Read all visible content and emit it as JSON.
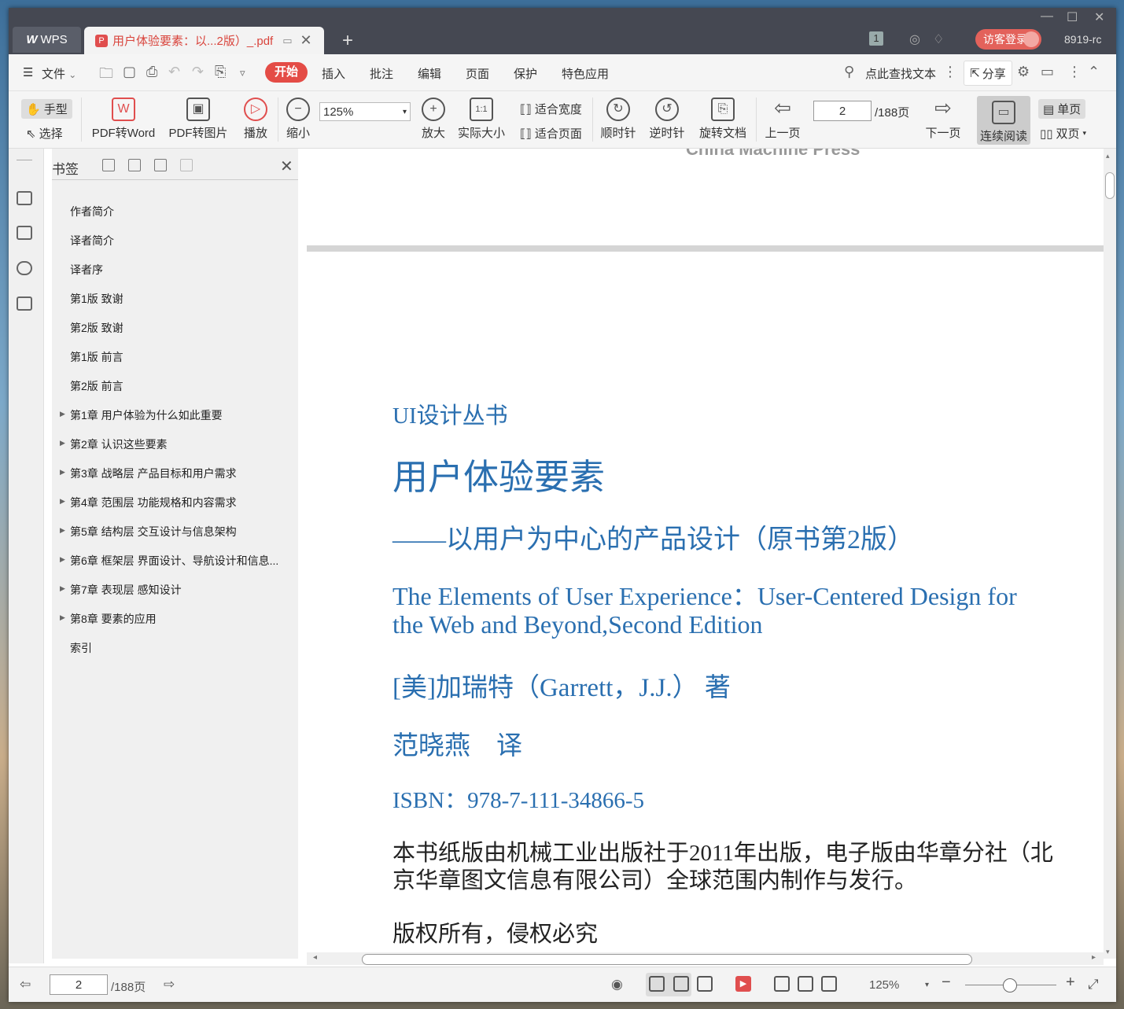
{
  "titlebar": {
    "app_tab": "WPS",
    "doc_tab": "用户体验要素：以...2版）_.pdf",
    "tab_count": "1",
    "login_label": "访客登录",
    "user_label": "8919-rc"
  },
  "menu": {
    "file": "文件",
    "tabs": [
      "开始",
      "插入",
      "批注",
      "编辑",
      "页面",
      "保护",
      "特色应用"
    ],
    "search_placeholder": "点此查找文本",
    "share": "分享"
  },
  "toolbar": {
    "hand": "手型",
    "select": "选择",
    "pdf_to_word": "PDF转Word",
    "pdf_to_image": "PDF转图片",
    "play": "播放",
    "zoom_out": "缩小",
    "zoom_value": "125%",
    "zoom_in": "放大",
    "actual_size": "实际大小",
    "fit_width": "适合宽度",
    "fit_page": "适合页面",
    "clockwise": "顺时针",
    "counter_clockwise": "逆时针",
    "rotate_doc": "旋转文档",
    "prev_page": "上一页",
    "page_value": "2",
    "page_total": "/188页",
    "next_page": "下一页",
    "continuous": "连续阅读",
    "single": "单页",
    "double": "双页"
  },
  "bookmarks": {
    "title": "书签",
    "items": [
      {
        "label": "作者简介",
        "expandable": false
      },
      {
        "label": "译者简介",
        "expandable": false
      },
      {
        "label": "译者序",
        "expandable": false
      },
      {
        "label": "第1版 致谢",
        "expandable": false
      },
      {
        "label": "第2版 致谢",
        "expandable": false
      },
      {
        "label": "第1版 前言",
        "expandable": false
      },
      {
        "label": "第2版 前言",
        "expandable": false
      },
      {
        "label": "第1章 用户体验为什么如此重要",
        "expandable": true
      },
      {
        "label": "第2章 认识这些要素",
        "expandable": true
      },
      {
        "label": "第3章 战略层 产品目标和用户需求",
        "expandable": true
      },
      {
        "label": "第4章 范围层 功能规格和内容需求",
        "expandable": true
      },
      {
        "label": "第5章 结构层 交互设计与信息架构",
        "expandable": true
      },
      {
        "label": "第6章 框架层 界面设计、导航设计和信息...",
        "expandable": true
      },
      {
        "label": "第7章 表现层 感知设计",
        "expandable": true
      },
      {
        "label": "第8章 要素的应用",
        "expandable": true
      },
      {
        "label": "索引",
        "expandable": false
      }
    ]
  },
  "document": {
    "prev_page_text": "China Machine Press",
    "series": "UI设计丛书",
    "title": "用户体验要素",
    "subtitle": "——以用户为中心的产品设计（原书第2版）",
    "english_title_1": "The Elements of User Experience：User-Centered Design for",
    "english_title_2": "the Web and Beyond,Second Edition",
    "author": "[美]加瑞特（Garrett，J.J.） 著",
    "translator": "范晓燕　译",
    "isbn": "ISBN：978-7-111-34866-5",
    "publish_1": "本书纸版由机械工业出版社于2011年出版，电子版由华章分社（北",
    "publish_2": "京华章图文信息有限公司）全球范围内制作与发行。",
    "copyright": "版权所有，侵权必究"
  },
  "statusbar": {
    "page_value": "2",
    "page_total": "/188页",
    "zoom": "125%"
  },
  "colors": {
    "accent": "#e44c46",
    "titlebar": "#454852",
    "doc_blue": "#2a6fb0"
  }
}
